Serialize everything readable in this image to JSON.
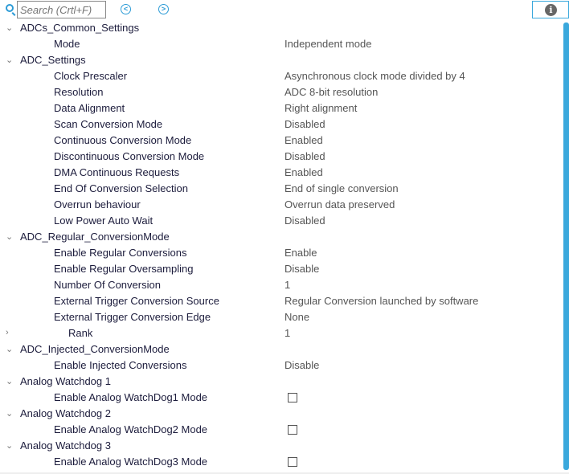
{
  "toolbar": {
    "search_placeholder": "Search (Crtl+F)",
    "info": "i"
  },
  "rows": [
    {
      "type": "group",
      "label": "ADCs_Common_Settings"
    },
    {
      "type": "prop",
      "label": "Mode",
      "value": "Independent mode"
    },
    {
      "type": "group",
      "label": "ADC_Settings"
    },
    {
      "type": "prop",
      "label": "Clock Prescaler",
      "value": "Asynchronous clock mode divided by 4"
    },
    {
      "type": "prop",
      "label": "Resolution",
      "value": "ADC 8-bit resolution"
    },
    {
      "type": "prop",
      "label": "Data Alignment",
      "value": "Right alignment"
    },
    {
      "type": "prop",
      "label": "Scan Conversion Mode",
      "value": "Disabled"
    },
    {
      "type": "prop",
      "label": "Continuous Conversion Mode",
      "value": "Enabled"
    },
    {
      "type": "prop",
      "label": "Discontinuous Conversion Mode",
      "value": "Disabled"
    },
    {
      "type": "prop",
      "label": "DMA Continuous Requests",
      "value": "Enabled"
    },
    {
      "type": "prop",
      "label": "End Of Conversion Selection",
      "value": "End of single conversion"
    },
    {
      "type": "prop",
      "label": "Overrun behaviour",
      "value": "Overrun data preserved"
    },
    {
      "type": "prop",
      "label": "Low Power Auto Wait",
      "value": "Disabled"
    },
    {
      "type": "group",
      "label": "ADC_Regular_ConversionMode"
    },
    {
      "type": "prop",
      "label": "Enable Regular Conversions",
      "value": "Enable"
    },
    {
      "type": "prop",
      "label": "Enable Regular Oversampling",
      "value": "Disable"
    },
    {
      "type": "prop",
      "label": "Number Of Conversion",
      "value": "1"
    },
    {
      "type": "prop",
      "label": "External Trigger Conversion Source",
      "value": "Regular Conversion launched by software"
    },
    {
      "type": "prop",
      "label": "External Trigger Conversion Edge",
      "value": "None"
    },
    {
      "type": "rank",
      "label": "Rank",
      "value": "1"
    },
    {
      "type": "group",
      "label": "ADC_Injected_ConversionMode"
    },
    {
      "type": "prop",
      "label": "Enable Injected Conversions",
      "value": "Disable"
    },
    {
      "type": "group",
      "label": "Analog Watchdog 1"
    },
    {
      "type": "check",
      "label": "Enable Analog WatchDog1 Mode",
      "checked": false
    },
    {
      "type": "group",
      "label": "Analog Watchdog 2"
    },
    {
      "type": "check",
      "label": "Enable Analog WatchDog2 Mode",
      "checked": false
    },
    {
      "type": "group",
      "label": "Analog Watchdog 3"
    },
    {
      "type": "check",
      "label": "Enable Analog WatchDog3 Mode",
      "checked": false
    }
  ]
}
